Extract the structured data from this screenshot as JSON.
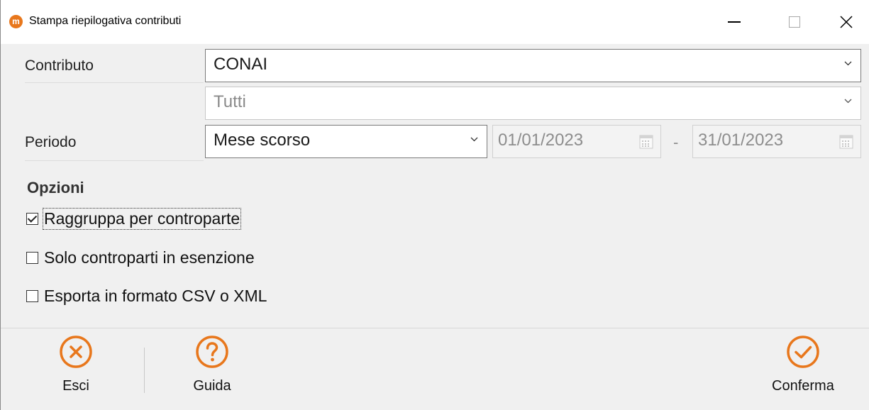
{
  "window": {
    "title": "Stampa riepilogativa contributi",
    "app_icon_letter": "m"
  },
  "form": {
    "contributo": {
      "label": "Contributo",
      "value": "CONAI"
    },
    "subcontributo": {
      "value": "Tutti"
    },
    "periodo": {
      "label": "Periodo",
      "value": "Mese scorso",
      "date_from": "01/01/2023",
      "separator": "-",
      "date_to": "31/01/2023"
    }
  },
  "options": {
    "title": "Opzioni",
    "items": [
      {
        "label": "Raggruppa per controparte",
        "checked": true
      },
      {
        "label": "Solo controparti in esenzione",
        "checked": false
      },
      {
        "label": "Esporta in formato CSV o XML",
        "checked": false
      }
    ]
  },
  "footer": {
    "exit_label": "Esci",
    "help_label": "Guida",
    "confirm_label": "Conferma"
  },
  "colors": {
    "accent": "#e8771c"
  }
}
